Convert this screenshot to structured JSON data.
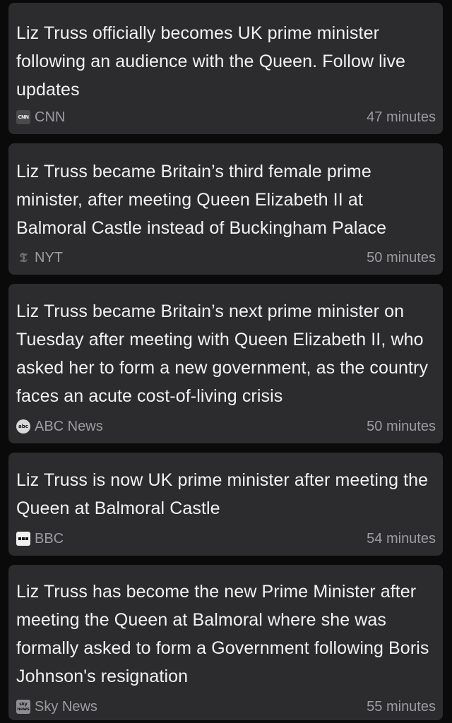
{
  "feed": {
    "items": [
      {
        "headline": "Liz Truss officially becomes UK prime minister following an audience with the Queen. Follow live updates",
        "source": "CNN",
        "source_icon": "cnn-logo-icon",
        "time": "47 minutes"
      },
      {
        "headline": "Liz Truss became Britain’s third female prime minister, after meeting Queen Elizabeth II at Balmoral Castle instead of Buckingham Palace",
        "source": "NYT",
        "source_icon": "nyt-logo-icon",
        "time": "50 minutes"
      },
      {
        "headline": "Liz Truss became Britain’s next prime minister on Tuesday after meeting with Queen Elizabeth II, who asked her to form a new government, as the country faces an acute cost-of-living crisis",
        "source": "ABC News",
        "source_icon": "abc-news-logo-icon",
        "time": "50 minutes"
      },
      {
        "headline": "Liz Truss is now UK prime minister after meeting the Queen at Balmoral Castle",
        "source": "BBC",
        "source_icon": "bbc-logo-icon",
        "time": "54 minutes"
      },
      {
        "headline": "Liz Truss has become the new Prime Minister after meeting the Queen at Balmoral where she was formally asked to form a Government following Boris Johnson's resignation",
        "source": "Sky News",
        "source_icon": "sky-news-logo-icon",
        "time": "55 minutes"
      }
    ]
  },
  "colors": {
    "background": "#0a0a0a",
    "card": "#2c2c2e",
    "headline_text": "#f2f2f2",
    "meta_text": "#9c9ca1"
  }
}
